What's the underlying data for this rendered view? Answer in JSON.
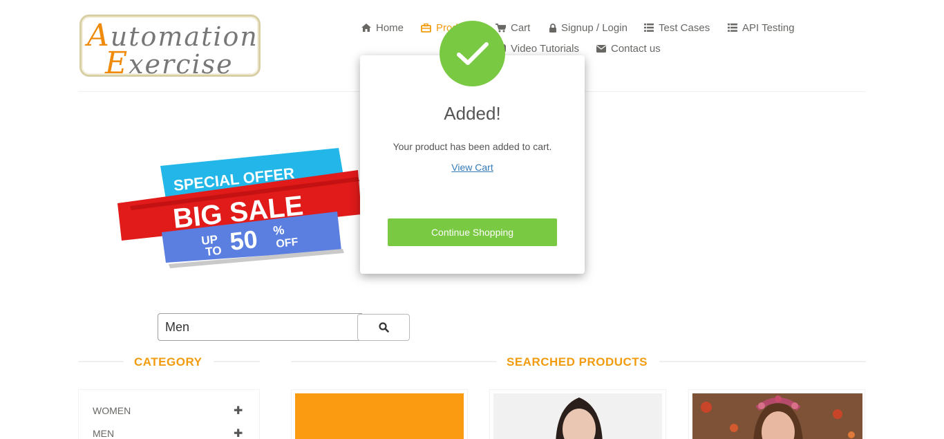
{
  "logo": {
    "line1": "utomation",
    "line1_cap": "A",
    "line2": "xercise",
    "line2_cap": "E"
  },
  "nav": {
    "items": [
      {
        "label": "Home",
        "icon": "home-icon"
      },
      {
        "label": "Products",
        "icon": "products-icon",
        "active": true
      },
      {
        "label": "Cart",
        "icon": "cart-icon"
      },
      {
        "label": "Signup / Login",
        "icon": "lock-icon"
      },
      {
        "label": "Test Cases",
        "icon": "list-icon"
      },
      {
        "label": "API Testing",
        "icon": "list-icon"
      },
      {
        "label": "Video Tutorials",
        "icon": "youtube-icon"
      },
      {
        "label": "Contact us",
        "icon": "envelope-icon"
      }
    ]
  },
  "banner": {
    "line1": "SPECIAL OFFER",
    "line2": "BIG SALE",
    "line3_up": "UP",
    "line3_to": "TO",
    "line3_pct": "50",
    "line3_sym": "%",
    "line3_off": "OFF"
  },
  "search": {
    "value": "Men"
  },
  "sidebar": {
    "title": "CATEGORY",
    "categories": [
      {
        "label": "Women"
      },
      {
        "label": "Men"
      }
    ]
  },
  "main": {
    "title": "SEARCHED PRODUCTS"
  },
  "modal": {
    "title": "Added!",
    "text": "Your product has been added to cart.",
    "link": "View Cart",
    "button": "Continue Shopping"
  },
  "colors": {
    "accent": "#f29b0e",
    "success": "#7ac943",
    "link": "#337ab7"
  }
}
